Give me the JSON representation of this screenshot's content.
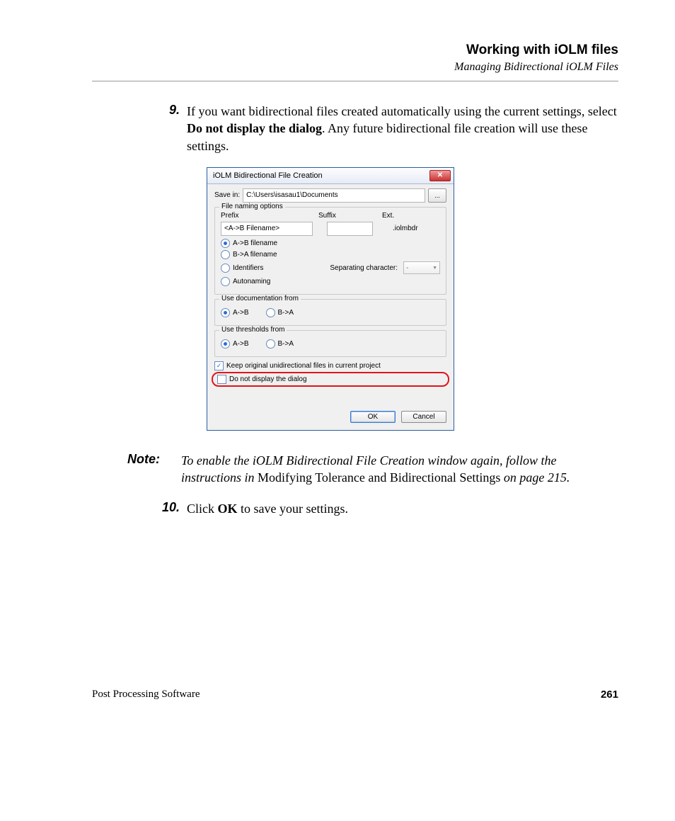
{
  "header": {
    "title": "Working with iOLM files",
    "subtitle": "Managing Bidirectional iOLM Files"
  },
  "step9": {
    "num": "9.",
    "text_pre": "If you want bidirectional files created automatically using the current settings, select ",
    "bold": "Do not display the dialog",
    "text_post": ". Any future bidirectional file creation will use these settings."
  },
  "dialog": {
    "title": "iOLM Bidirectional File Creation",
    "save_in_label": "Save in:",
    "save_path": "C:\\Users\\isasau1\\Documents",
    "browse": "...",
    "group_naming": "File naming options",
    "col_prefix": "Prefix",
    "col_suffix": "Suffix",
    "col_ext": "Ext.",
    "prefix_value": "<A->B Filename>",
    "suffix_value": "",
    "ext_value": ".iolmbdr",
    "radios": {
      "ab": "A->B filename",
      "ba": "B->A filename",
      "identifiers": "Identifiers",
      "autonaming": "Autonaming"
    },
    "sep_label": "Separating character:",
    "sep_value": "-",
    "group_doc": "Use documentation from",
    "group_thr": "Use thresholds from",
    "opt_ab": "A->B",
    "opt_ba": "B->A",
    "keep_original": "Keep original unidirectional files in current project",
    "do_not_display": "Do not display the dialog",
    "ok": "OK",
    "cancel": "Cancel"
  },
  "note": {
    "label": "Note:",
    "pre": "To enable the iOLM Bidirectional File Creation window again, follow the instructions in ",
    "roman": "Modifying Tolerance and Bidirectional Settings",
    "post": " on page 215."
  },
  "step10": {
    "num": "10.",
    "pre": "Click ",
    "bold": "OK",
    "post": " to save your settings."
  },
  "footer": {
    "product": "Post Processing Software",
    "page": "261"
  }
}
